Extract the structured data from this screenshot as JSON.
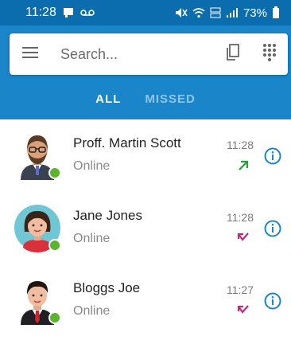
{
  "status_bar": {
    "time": "11:28",
    "battery": "73%"
  },
  "search": {
    "placeholder": "Search..."
  },
  "tabs": [
    {
      "label": "ALL",
      "active": true
    },
    {
      "label": "MISSED",
      "active": false
    }
  ],
  "calls": [
    {
      "name": "Proff. Martin Scott",
      "status": "Online",
      "time": "11:28",
      "direction": "outgoing"
    },
    {
      "name": "Jane Jones",
      "status": "Online",
      "time": "11:28",
      "direction": "missed"
    },
    {
      "name": "Bloggs Joe",
      "status": "Online",
      "time": "11:27",
      "direction": "missed"
    }
  ],
  "colors": {
    "header": "#1a85c8",
    "status_bar": "#0b6dad",
    "online": "#5ab52c",
    "outgoing": "#2e9e3c",
    "missed": "#c2297a",
    "info": "#1a85c8"
  },
  "icons": {
    "menu": "menu-icon",
    "copy": "copy-icon",
    "dialpad": "dialpad-icon",
    "info": "info-icon",
    "outgoing": "outgoing-call-icon",
    "missed": "missed-call-icon"
  }
}
